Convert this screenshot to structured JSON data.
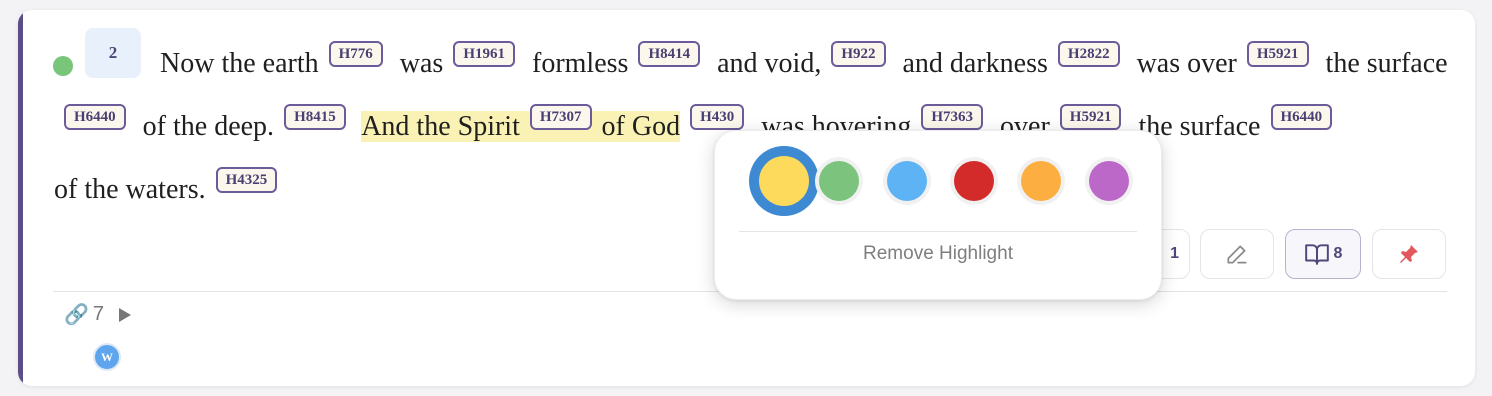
{
  "verse": {
    "number": "2",
    "segments": [
      {
        "text": "Now the earth",
        "tag": "H776"
      },
      {
        "text": "was",
        "tag": "H1961"
      },
      {
        "text": "formless",
        "tag": "H8414"
      },
      {
        "text": "and void,",
        "tag": "H922"
      },
      {
        "text": "and darkness",
        "tag": "H2822"
      },
      {
        "text": "was over",
        "tag": "H5921"
      },
      {
        "text": "the surface",
        "tag": "H6440"
      },
      {
        "text": "of the deep.",
        "tag": "H8415"
      },
      {
        "text": "And the Spirit",
        "tag": "H7307",
        "highlight": true
      },
      {
        "text": "of God",
        "tag": "H430",
        "highlight": true
      },
      {
        "text": "was hovering",
        "tag": "H7363"
      },
      {
        "text": "over",
        "tag": "H5921"
      },
      {
        "text": "the surface",
        "tag": "H6440"
      },
      {
        "text": "of the waters.",
        "tag": "H4325"
      }
    ]
  },
  "actions": {
    "count_button": "1",
    "bible_count": "8"
  },
  "links": {
    "count": "7",
    "badge_letter": "W"
  },
  "highlight_popup": {
    "colors": [
      {
        "name": "yellow",
        "hex": "#fdd95c",
        "selected": true
      },
      {
        "name": "green",
        "hex": "#7cc47d"
      },
      {
        "name": "blue",
        "hex": "#5db3f3"
      },
      {
        "name": "red",
        "hex": "#d32a2a"
      },
      {
        "name": "orange",
        "hex": "#fdae41"
      },
      {
        "name": "purple",
        "hex": "#bc68c8"
      }
    ],
    "remove_label": "Remove Highlight"
  },
  "colors": {
    "accent": "#5c4d87",
    "highlight": "#faf2b4",
    "status": "#79c57a"
  }
}
